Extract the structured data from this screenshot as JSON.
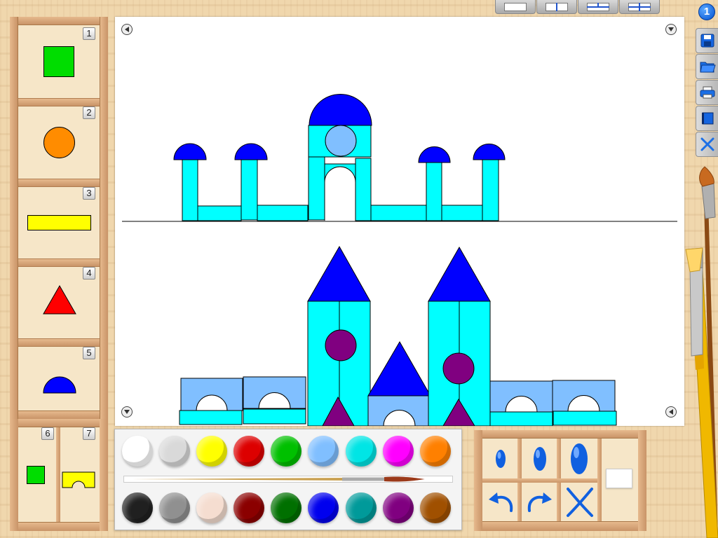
{
  "app": {
    "page_badge": "1",
    "layout_buttons": [
      "single-layout",
      "vertical-split-layout",
      "horizontal-split-layout",
      "quad-split-layout"
    ]
  },
  "colors": {
    "green": "#00dd00",
    "orange": "#ff8c00",
    "yellow": "#ffff00",
    "red": "#ff0000",
    "blue": "#0000ff",
    "cyan": "#00ffff",
    "light_blue": "#80bfff",
    "purple": "#800080"
  },
  "shape_library": {
    "slots": [
      {
        "number": "1",
        "shape": "square",
        "color": "#00dd00"
      },
      {
        "number": "2",
        "shape": "circle",
        "color": "#ff8c00"
      },
      {
        "number": "3",
        "shape": "rectangle",
        "color": "#ffff00"
      },
      {
        "number": "4",
        "shape": "triangle",
        "color": "#ff0000"
      },
      {
        "number": "5",
        "shape": "half-dome",
        "color": "#0000ff"
      }
    ],
    "extra_slots": [
      {
        "number": "6",
        "shape": "small-square",
        "color": "#00dd00"
      },
      {
        "number": "7",
        "shape": "arch-block",
        "color": "#ffff00"
      }
    ]
  },
  "right_toolbar": [
    "save-icon",
    "open-folder-icon",
    "print-icon",
    "notebook-icon",
    "close-icon"
  ],
  "palette": {
    "row1": [
      "#ffffff",
      "#d9d9d9",
      "#ffff00",
      "#dd0000",
      "#00c000",
      "#80bfff",
      "#00e5e5",
      "#ff00ff",
      "#ff8000"
    ],
    "row2": [
      "#202020",
      "#909090",
      "#f5ddd0",
      "#8b0000",
      "#007000",
      "#0000ee",
      "#009a9a",
      "#800080",
      "#a05000"
    ]
  },
  "tools": {
    "sizes": [
      "small-brush-size",
      "medium-brush-size",
      "large-brush-size"
    ],
    "actions": [
      "undo-icon",
      "redo-icon",
      "clear-icon"
    ],
    "current_color": "#ffffff"
  }
}
